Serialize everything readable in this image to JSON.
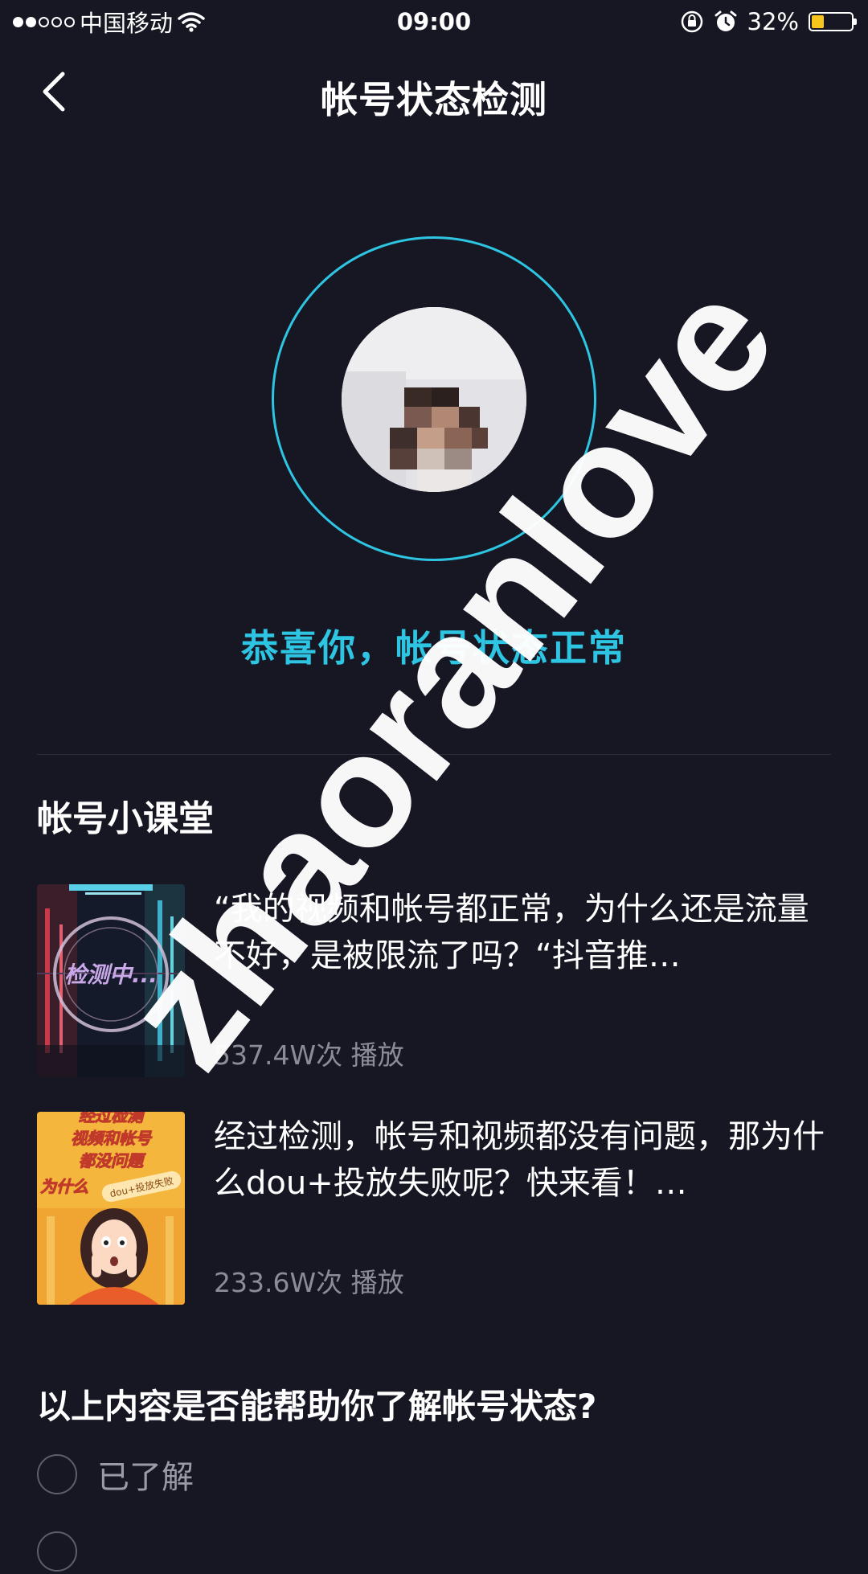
{
  "status_bar": {
    "carrier": "中国移动",
    "time": "09:00",
    "battery_text": "32%",
    "battery_level": 0.32,
    "signal_bars_filled": 2,
    "signal_bars_total": 5,
    "icons": [
      "signal-icon",
      "wifi-icon",
      "rotation-lock-icon",
      "alarm-icon",
      "battery-icon"
    ],
    "battery_color": "#f7c51b"
  },
  "nav": {
    "title": "帐号状态检测",
    "back_icon": "chevron-left-icon"
  },
  "check": {
    "status_message": "恭喜你，帐号状态正常",
    "accent_color": "#2ec5e3"
  },
  "classroom": {
    "title": "帐号小课堂",
    "items": [
      {
        "title": "“我的视频和帐号都正常，为什么还是流量不好，是被限流了吗？“抖音推…",
        "meta": "537.4W次 播放",
        "thumb_text": "检测中..."
      },
      {
        "title": "经过检测，帐号和视频都没有问题，那为什么dou+投放失败呢？快来看！…",
        "meta": "233.6W次 播放",
        "thumb_lines": [
          "经过检测",
          "视频和帐号",
          "都没问题",
          "为什么"
        ],
        "thumb_tag": "dou+投放失败"
      }
    ]
  },
  "feedback": {
    "question": "以上内容是否能帮助你了解帐号状态?",
    "options": [
      "已了解"
    ]
  },
  "watermark": "zhaoranlove"
}
